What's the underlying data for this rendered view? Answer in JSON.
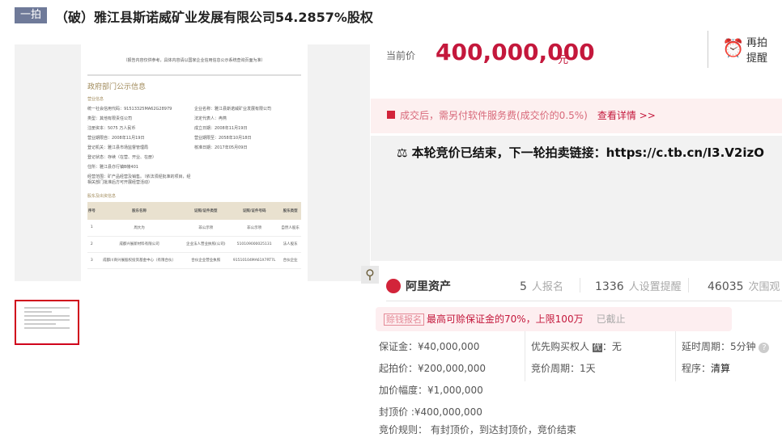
{
  "header": {
    "tag": "一拍",
    "title": "（破）雅江县斯诺威矿业发展有限公司54.2857%股权"
  },
  "gallery": {
    "doc": {
      "note": "（报告内容仅供参考，具体内容请以国家企业信用信息公示系统查询页面为准）",
      "heading": "政府部门公示信息",
      "section1": "营业信息",
      "rows": [
        [
          "统一社会信用代码：91513325MA62G28979",
          "企业名称：雅江县斯诺威矿业发展有限公司"
        ],
        [
          "类型：其他有限责任公司",
          "法定代表人：冉燕"
        ],
        [
          "注册资本：5075 万人民币",
          "成立日期：2008年11月19日"
        ],
        [
          "营业期限自：2008年11月19日",
          "营业期限至：2058年10月18日"
        ],
        [
          "登记机关：雅江县市场监督管理局",
          "核准日期：2017年05月09日"
        ],
        [
          "登记状态：存续（在营、开业、在册）",
          ""
        ],
        [
          "住所：雅江县亦行镇B幢401",
          ""
        ],
        [
          "经营范围：矿产品经营及销售。（依法须经批准的项目，经相关部门批准后方可开展经营活动）",
          ""
        ]
      ],
      "section2": "股东及出资信息",
      "table_headers": [
        "序号",
        "股东名称",
        "证照/证件类型",
        "证照/证件号码",
        "股东类型"
      ],
      "table_rows": [
        [
          "1",
          "周大为",
          "非公示项",
          "非公示项",
          "自然人股东"
        ],
        [
          "2",
          "成都兴展新材料有限公司",
          "企业法人营业执照(公司)",
          "510109000025131",
          "法人股东"
        ],
        [
          "3",
          "成都川商兴展股权投资基金中心（有限合伙）",
          "合伙企业营业执照",
          "91510104MA61X7RT7L",
          "合伙企业"
        ]
      ]
    }
  },
  "price": {
    "label": "当前价",
    "value": "400,000,000",
    "unit": "元",
    "remind": "再拍",
    "remind2": "提醒"
  },
  "fee": {
    "text": "成交后，需另付软件服务费(成交价的0.5%)",
    "link": "查看详情 >>"
  },
  "ended": {
    "text": "本轮竞价已结束，下一轮拍卖链接：https://c.tb.cn/I3.V2izO"
  },
  "platform": {
    "name": "阿里资产"
  },
  "stats": [
    {
      "num": "5",
      "label": "人报名"
    },
    {
      "num": "1336",
      "label": "人设置提醒"
    },
    {
      "num": "46035",
      "label": "次围观"
    }
  ],
  "promo": {
    "badge": "赊钱报名",
    "text": "最高可赊保证金的70%，上限100万",
    "status": "已截止"
  },
  "info": {
    "deposit": "保证金：¥40,000,000",
    "start": "起拍价：¥200,000,000",
    "increment": "加价幅度：¥1,000,000",
    "cap": "封顶价 :¥400,000,000",
    "rule": "竞价规则： 有封顶价，到达封顶价，竞价结束",
    "priority_label": "优先购买权人",
    "priority_badge": "优",
    "priority_value": "：无",
    "cycle": "竞价周期：1天",
    "delay": "延时周期：5分钟",
    "procedure_label": "程序：",
    "procedure_value": "清算"
  },
  "colors": {
    "accent": "#c4183c",
    "tag": "#6f7a99",
    "fee_bg": "#fdf0f0"
  }
}
